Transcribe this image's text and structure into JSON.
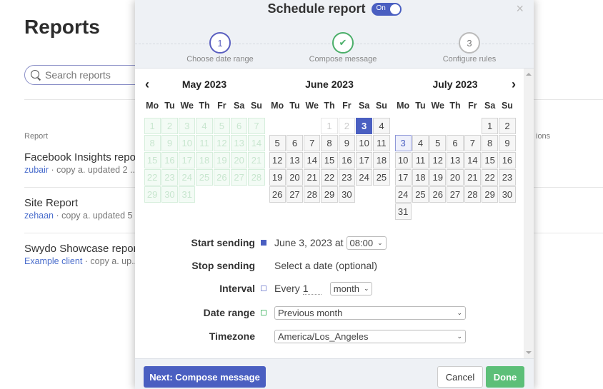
{
  "background": {
    "title": "Reports",
    "search": {
      "placeholder": "Search reports",
      "value": ""
    },
    "columns": {
      "report": "Report",
      "actions": "ions"
    },
    "reports": [
      {
        "name": "Facebook Insights repo",
        "client": "zubair",
        "meta": " · copy a. updated 2 ..."
      },
      {
        "name": "Site Report",
        "client": "zehaan",
        "meta": " · copy a. updated 5 ..."
      },
      {
        "name": "Swydo Showcase repor",
        "client": "Example client",
        "meta": " · copy a. up..."
      }
    ]
  },
  "modal": {
    "title": "Schedule report",
    "toggle_label": "On",
    "toggle_on": true,
    "close_icon": "×",
    "steps": [
      {
        "number": "1",
        "label": "Choose date range",
        "state": "current"
      },
      {
        "number": "✔",
        "label": "Compose message",
        "state": "done"
      },
      {
        "number": "3",
        "label": "Configure rules",
        "state": "todo"
      }
    ],
    "calendar": {
      "prev_icon": "‹",
      "next_icon": "›",
      "weekdays": [
        "Mo",
        "Tu",
        "We",
        "Th",
        "Fr",
        "Sa",
        "Su"
      ],
      "months": [
        {
          "title": "May 2023",
          "offset": 0,
          "days": 31,
          "disabled_until": 31,
          "faded": [],
          "selected": null,
          "highlight": null
        },
        {
          "title": "June 2023",
          "offset": 3,
          "days": 30,
          "disabled_until": 0,
          "faded": [
            1,
            2
          ],
          "selected": 3,
          "highlight": null
        },
        {
          "title": "July 2023",
          "offset": 5,
          "days": 31,
          "disabled_until": 0,
          "faded": [],
          "selected": null,
          "highlight": 3
        }
      ]
    },
    "form": {
      "start_sending": {
        "label": "Start sending",
        "date": "June 3, 2023 at",
        "time": "08:00"
      },
      "stop_sending": {
        "label": "Stop sending",
        "value": "Select a date (optional)"
      },
      "interval": {
        "label": "Interval",
        "prefix": "Every",
        "count": "1",
        "unit": "month"
      },
      "date_range": {
        "label": "Date range",
        "value": "Previous month"
      },
      "timezone": {
        "label": "Timezone",
        "value": "America/Los_Angeles"
      }
    },
    "footer": {
      "next_label": "Next: Compose message",
      "cancel_label": "Cancel",
      "done_label": "Done"
    }
  },
  "colors": {
    "accent": "#4a5fc1",
    "success": "#5cbf78",
    "link": "#4a6dcc"
  }
}
